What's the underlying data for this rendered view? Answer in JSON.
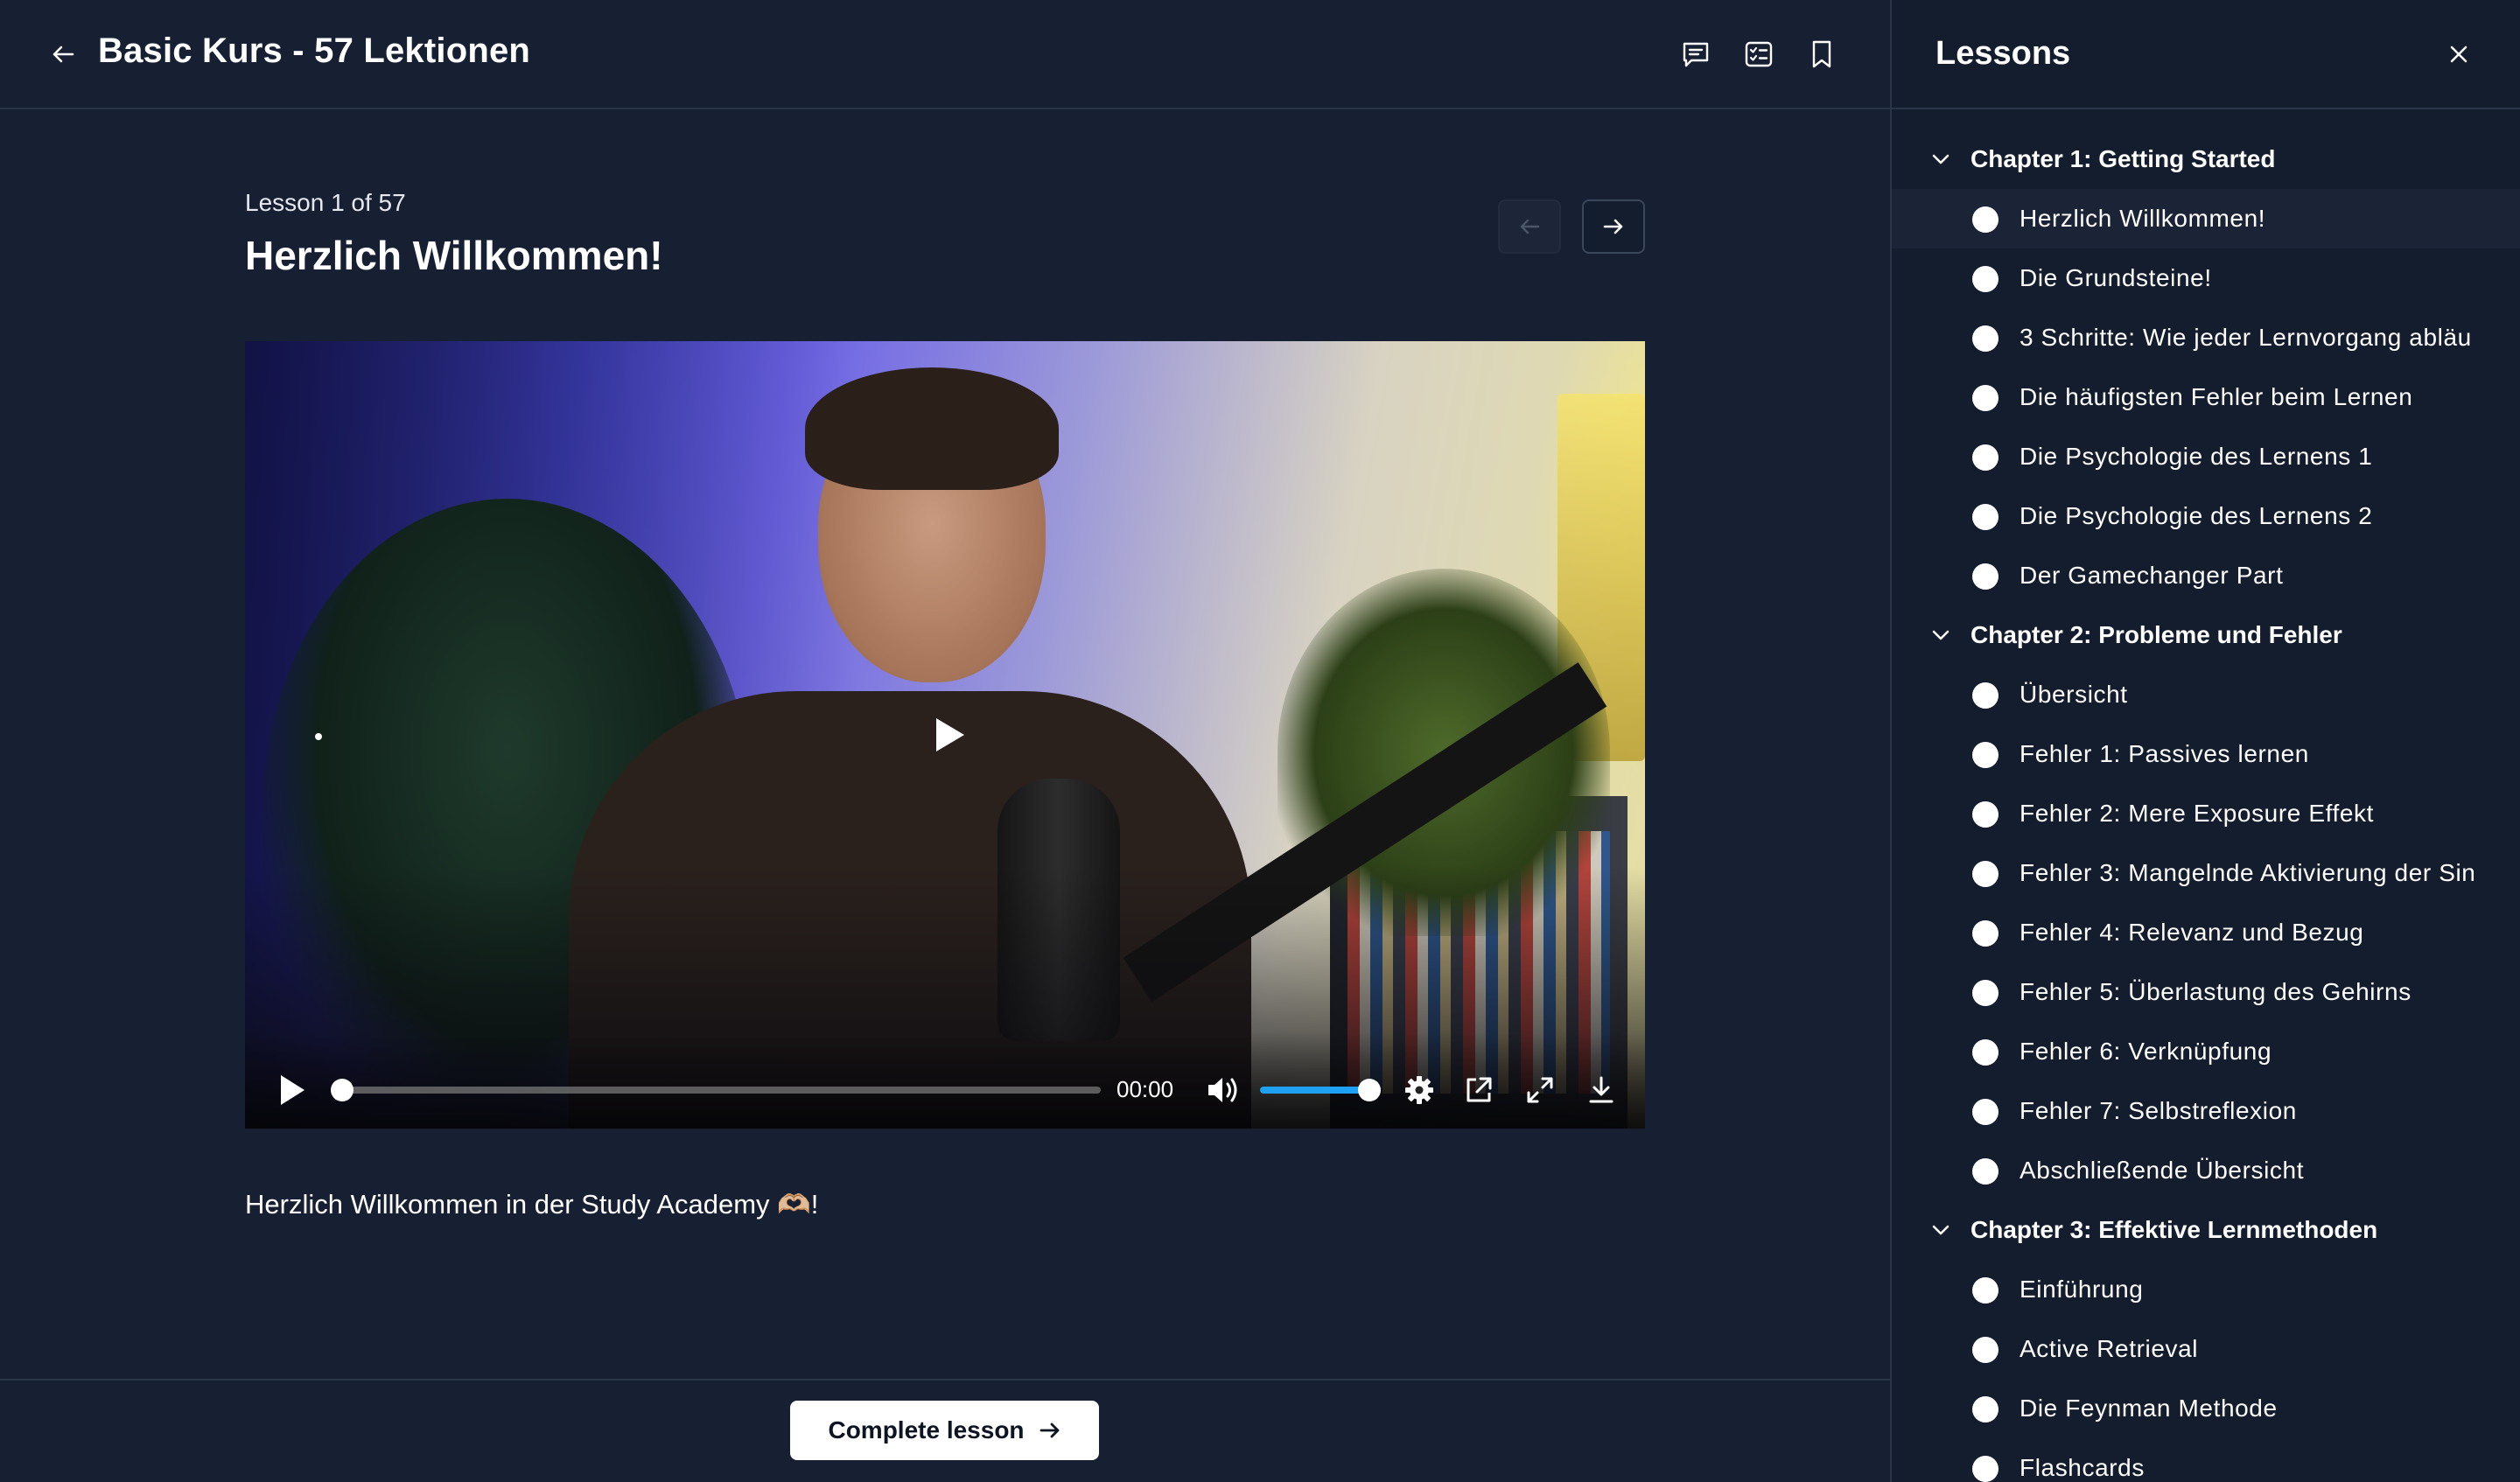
{
  "header": {
    "course_title": "Basic Kurs - 57 Lektionen",
    "icons": [
      "back-arrow-icon",
      "comment-icon",
      "checklist-icon",
      "bookmark-icon"
    ]
  },
  "lesson": {
    "counter": "Lesson 1 of 57",
    "title": "Herzlich Willkommen!",
    "description": "Herzlich Willkommen in der Study Academy 🫶🏼!"
  },
  "video": {
    "time": "00:00",
    "progress": 0,
    "volume": 1.0
  },
  "footer": {
    "complete_label": "Complete lesson"
  },
  "sidebar": {
    "title": "Lessons",
    "chapters": [
      {
        "label": "Chapter 1: Getting Started",
        "lessons": [
          "Herzlich Willkommen!",
          "Die Grundsteine!",
          "3 Schritte: Wie jeder Lernvorgang abläu",
          "Die häufigsten Fehler beim Lernen",
          "Die Psychologie des Lernens 1",
          "Die Psychologie des Lernens 2",
          "Der Gamechanger Part"
        ]
      },
      {
        "label": "Chapter 2: Probleme und Fehler",
        "lessons": [
          "Übersicht",
          "Fehler 1: Passives lernen",
          "Fehler 2: Mere Exposure Effekt",
          "Fehler 3: Mangelnde Aktivierung der Sin",
          "Fehler 4: Relevanz und Bezug",
          "Fehler 5: Überlastung des Gehirns",
          "Fehler 6: Verknüpfung",
          "Fehler 7: Selbstreflexion",
          "Abschließende Übersicht"
        ]
      },
      {
        "label": "Chapter 3: Effektive Lernmethoden",
        "lessons": [
          "Einführung",
          "Active Retrieval",
          "Die Feynman Methode",
          "Flashcards"
        ]
      }
    ]
  },
  "colors": {
    "background": "#172033",
    "sidebar_background": "#141d2d",
    "accent_volume": "#1ea0f3",
    "button_background": "#ffffff"
  }
}
